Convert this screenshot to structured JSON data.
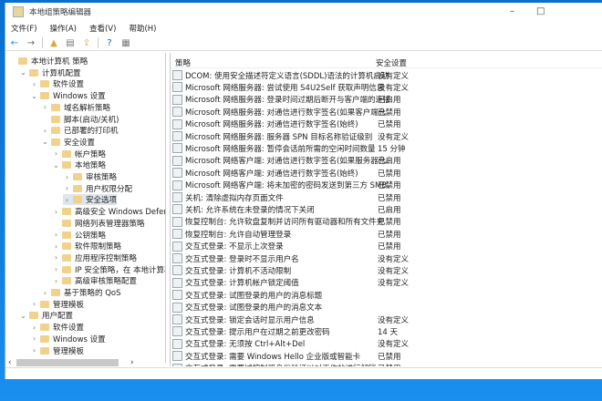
{
  "window": {
    "title": "本地组策略编辑器",
    "minimize": "–",
    "maximize": "□",
    "close": "×"
  },
  "menu": [
    "文件(F)",
    "操作(A)",
    "查看(V)",
    "帮助(H)"
  ],
  "toolbar": [
    {
      "icon": "back-icon",
      "glyph": "←",
      "color": "#1e88e5"
    },
    {
      "icon": "forward-icon",
      "glyph": "→",
      "color": "#666"
    },
    {
      "icon": "up-folder-icon",
      "glyph": "▲",
      "color": "#d9a93c"
    },
    {
      "icon": "show-hide-tree-icon",
      "glyph": "▤",
      "color": "#777"
    },
    {
      "icon": "export-list-icon",
      "glyph": "⇪",
      "color": "#d9a93c"
    },
    {
      "icon": "help-icon",
      "glyph": "?",
      "color": "#1e5fb0"
    },
    {
      "icon": "properties-icon",
      "glyph": "▦",
      "color": "#777"
    }
  ],
  "tree": [
    {
      "label": "本地计算机 策略",
      "level": 0,
      "arrow": ""
    },
    {
      "label": "计算机配置",
      "level": 1,
      "arrow": "⌄"
    },
    {
      "label": "软件设置",
      "level": 2,
      "arrow": "›"
    },
    {
      "label": "Windows 设置",
      "level": 2,
      "arrow": "⌄"
    },
    {
      "label": "域名解析策略",
      "level": 3,
      "arrow": "›"
    },
    {
      "label": "脚本(启动/关机)",
      "level": 3,
      "arrow": ""
    },
    {
      "label": "已部署的打印机",
      "level": 3,
      "arrow": "›"
    },
    {
      "label": "安全设置",
      "level": 3,
      "arrow": "⌄"
    },
    {
      "label": "帐户策略",
      "level": 4,
      "arrow": "›"
    },
    {
      "label": "本地策略",
      "level": 4,
      "arrow": "⌄"
    },
    {
      "label": "审核策略",
      "level": 5,
      "arrow": "›"
    },
    {
      "label": "用户权限分配",
      "level": 5,
      "arrow": "›"
    },
    {
      "label": "安全选项",
      "level": 5,
      "arrow": "›",
      "selected": true
    },
    {
      "label": "高级安全 Windows Defender 防",
      "level": 4,
      "arrow": "›"
    },
    {
      "label": "网络列表管理器策略",
      "level": 4,
      "arrow": ""
    },
    {
      "label": "公钥策略",
      "level": 4,
      "arrow": "›"
    },
    {
      "label": "软件限制策略",
      "level": 4,
      "arrow": "›"
    },
    {
      "label": "应用程序控制策略",
      "level": 4,
      "arrow": "›"
    },
    {
      "label": "IP 安全策略，在 本地计算机",
      "level": 4,
      "arrow": "›"
    },
    {
      "label": "高级审核策略配置",
      "level": 4,
      "arrow": "›"
    },
    {
      "label": "基于策略的 QoS",
      "level": 3,
      "arrow": "›"
    },
    {
      "label": "管理模板",
      "level": 2,
      "arrow": "›"
    },
    {
      "label": "用户配置",
      "level": 1,
      "arrow": "⌄"
    },
    {
      "label": "软件设置",
      "level": 2,
      "arrow": "›"
    },
    {
      "label": "Windows 设置",
      "level": 2,
      "arrow": "›"
    },
    {
      "label": "管理模板",
      "level": 2,
      "arrow": "›"
    }
  ],
  "list": {
    "columns": [
      "策略",
      "安全设置"
    ],
    "rows": [
      {
        "policy": "DCOM: 使用安全描述符定义语言(SDDL)语法的计算机启动...",
        "setting": "没有定义"
      },
      {
        "policy": "Microsoft 网络服务器: 尝试使用 S4U2Self 获取声明信息",
        "setting": "没有定义"
      },
      {
        "policy": "Microsoft 网络服务器: 登录时间过期后断开与客户端的连接",
        "setting": "已启用"
      },
      {
        "policy": "Microsoft 网络服务器: 对通信进行数字签名(如果客户端允...",
        "setting": "已禁用"
      },
      {
        "policy": "Microsoft 网络服务器: 对通信进行数字签名(始终)",
        "setting": "已禁用"
      },
      {
        "policy": "Microsoft 网络服务器: 服务器 SPN 目标名称验证级别",
        "setting": "没有定义"
      },
      {
        "policy": "Microsoft 网络服务器: 暂停会话前所需的空闲时间数量",
        "setting": "15 分钟"
      },
      {
        "policy": "Microsoft 网络客户端: 对通信进行数字签名(如果服务器允...",
        "setting": "已启用"
      },
      {
        "policy": "Microsoft 网络客户端: 对通信进行数字签名(始终)",
        "setting": "已禁用"
      },
      {
        "policy": "Microsoft 网络客户端: 将未加密的密码发送到第三方 SMB...",
        "setting": "已禁用"
      },
      {
        "policy": "关机: 清除虚拟内存页面文件",
        "setting": "已禁用"
      },
      {
        "policy": "关机: 允许系统在未登录的情况下关闭",
        "setting": "已启用"
      },
      {
        "policy": "恢复控制台: 允许软盘复制并访问所有驱动器和所有文件夹",
        "setting": "已禁用"
      },
      {
        "policy": "恢复控制台: 允许自动管理登录",
        "setting": "已禁用"
      },
      {
        "policy": "交互式登录: 不显示上次登录",
        "setting": "已禁用"
      },
      {
        "policy": "交互式登录: 登录时不显示用户名",
        "setting": "没有定义"
      },
      {
        "policy": "交互式登录: 计算机不活动限制",
        "setting": "没有定义"
      },
      {
        "policy": "交互式登录: 计算机帐户锁定阈值",
        "setting": "没有定义"
      },
      {
        "policy": "交互式登录: 试图登录的用户的消息标题",
        "setting": ""
      },
      {
        "policy": "交互式登录: 试图登录的用户的消息文本",
        "setting": ""
      },
      {
        "policy": "交互式登录: 锁定会话时显示用户信息",
        "setting": "没有定义"
      },
      {
        "policy": "交互式登录: 提示用户在过期之前更改密码",
        "setting": "14 天"
      },
      {
        "policy": "交互式登录: 无须按 Ctrl+Alt+Del",
        "setting": "没有定义"
      },
      {
        "policy": "交互式登录: 需要 Windows Hello 企业版或智能卡",
        "setting": "已禁用"
      },
      {
        "policy": "交互式登录: 需要域控制器身份验证以对工作站进行解锁",
        "setting": "已禁用"
      }
    ]
  },
  "scroll": {
    "left": "‹",
    "right": "›"
  }
}
